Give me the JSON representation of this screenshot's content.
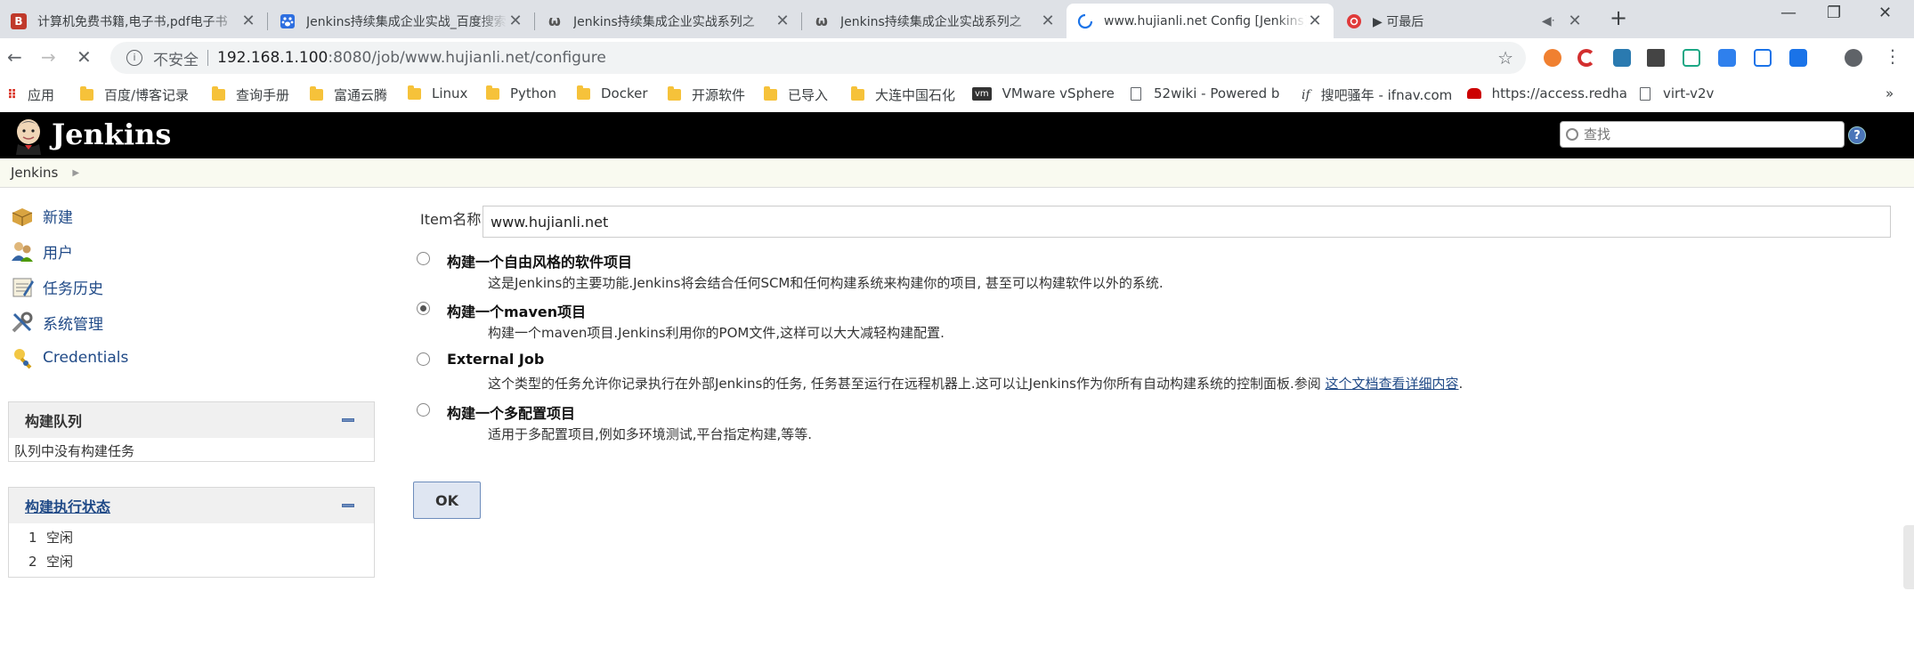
{
  "tabs": [
    {
      "title": "计算机免费书籍,电子书,pdf电子书",
      "favicon": "B"
    },
    {
      "title": "Jenkins持续集成企业实战_百度搜索",
      "favicon": "paw"
    },
    {
      "title": "Jenkins持续集成企业实战系列之",
      "favicon": "ω"
    },
    {
      "title": "Jenkins持续集成企业实战系列之",
      "favicon": "ω"
    },
    {
      "title": "www.hujianli.net Config [Jenkins]",
      "favicon": "loading"
    },
    {
      "title": "▶ 可最后",
      "favicon": "netease"
    }
  ],
  "address": {
    "security_label": "不安全",
    "host": "192.168.1.100",
    "path": ":8080/job/www.hujianli.net/configure"
  },
  "bookmarks": [
    {
      "label": "应用",
      "type": "apps"
    },
    {
      "label": "百度/博客记录",
      "type": "folder"
    },
    {
      "label": "查询手册",
      "type": "folder"
    },
    {
      "label": "富通云腾",
      "type": "folder"
    },
    {
      "label": "Linux",
      "type": "folder"
    },
    {
      "label": "Python",
      "type": "folder"
    },
    {
      "label": "Docker",
      "type": "folder"
    },
    {
      "label": "开源软件",
      "type": "folder"
    },
    {
      "label": "已导入",
      "type": "folder"
    },
    {
      "label": "大连中国石化",
      "type": "folder"
    },
    {
      "label": "VMware vSphere",
      "type": "vm"
    },
    {
      "label": "52wiki - Powered b",
      "type": "page"
    },
    {
      "label": "搜吧骚年 - ifnav.com",
      "type": "if"
    },
    {
      "label": "https://access.redha",
      "type": "redhat"
    },
    {
      "label": "virt-v2v",
      "type": "page"
    }
  ],
  "jenkins": {
    "title": "Jenkins",
    "search_placeholder": "查找",
    "help": "?"
  },
  "breadcrumb": {
    "root": "Jenkins"
  },
  "sidebar": {
    "tasks": [
      {
        "label": "新建",
        "icon": "new-item-icon"
      },
      {
        "label": "用户",
        "icon": "people-icon"
      },
      {
        "label": "任务历史",
        "icon": "notepad-icon"
      },
      {
        "label": "系统管理",
        "icon": "setting-icon"
      },
      {
        "label": "Credentials",
        "icon": "credentials-icon"
      }
    ],
    "queue": {
      "title": "构建队列",
      "empty": "队列中没有构建任务"
    },
    "executors": {
      "title": "构建执行状态",
      "rows": [
        {
          "num": "1",
          "status": "空闲"
        },
        {
          "num": "2",
          "status": "空闲"
        }
      ]
    }
  },
  "form": {
    "item_label": "Item名称",
    "item_value": "www.hujianli.net",
    "options": [
      {
        "title": "构建一个自由风格的软件项目",
        "desc": "这是Jenkins的主要功能.Jenkins将会结合任何SCM和任何构建系统来构建你的项目, 甚至可以构建软件以外的系统.",
        "checked": false
      },
      {
        "title": "构建一个maven项目",
        "desc": "构建一个maven项目.Jenkins利用你的POM文件,这样可以大大减轻构建配置.",
        "checked": true
      },
      {
        "title": "External Job",
        "desc": "这个类型的任务允许你记录执行在外部Jenkins的任务, 任务甚至运行在远程机器上.这可以让Jenkins作为你所有自动构建系统的控制面板.参阅",
        "link": "这个文档查看详细内容",
        "tail": ".",
        "checked": false
      },
      {
        "title": "构建一个多配置项目",
        "desc": "适用于多配置项目,例如多环境测试,平台指定构建,等等.",
        "checked": false
      }
    ],
    "ok_label": "OK"
  }
}
